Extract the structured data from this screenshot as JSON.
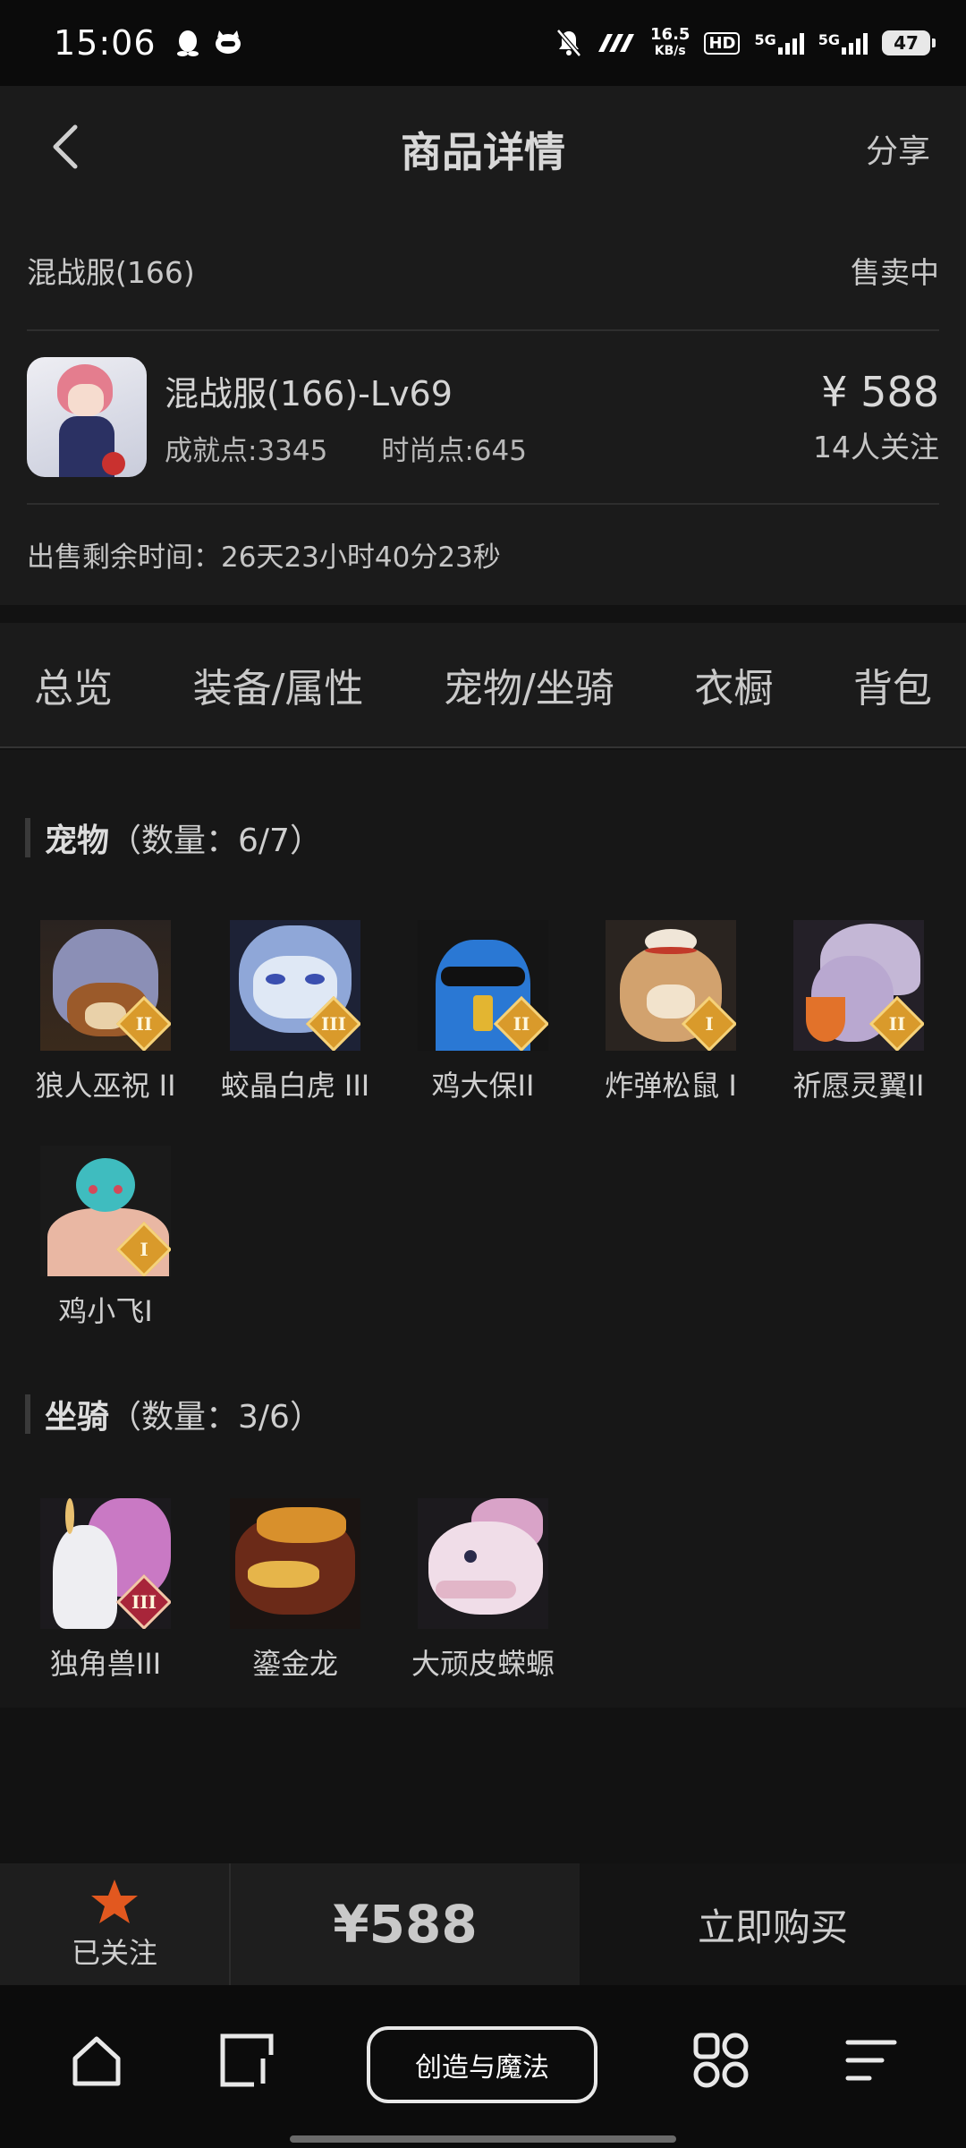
{
  "status_bar": {
    "time": "15:06",
    "speed_value": "16.5",
    "speed_unit": "KB/s",
    "hd": "HD",
    "net1": "5G",
    "net2": "5G",
    "battery": "47"
  },
  "header": {
    "title": "商品详情",
    "share": "分享",
    "back_icon": "chevron-left-icon"
  },
  "info": {
    "server": "混战服(166)",
    "status": "售卖中",
    "product_name": "混战服(166)-Lv69",
    "achievement": "成就点:3345",
    "fashion": "时尚点:645",
    "price": "¥ 588",
    "followers": "14人关注",
    "remaining_time": "出售剩余时间：26天23小时40分23秒"
  },
  "tabs": [
    {
      "label": "总览"
    },
    {
      "label": "装备/属性"
    },
    {
      "label": "宠物/坐骑"
    },
    {
      "label": "衣橱"
    },
    {
      "label": "背包"
    }
  ],
  "pets": {
    "title": "宠物",
    "count": "（数量：6/7）",
    "items": [
      {
        "name": "狼人巫祝 II",
        "rank": "II"
      },
      {
        "name": "蛟晶白虎 III",
        "rank": "III"
      },
      {
        "name": "鸡大保II",
        "rank": "II"
      },
      {
        "name": "炸弹松鼠 I",
        "rank": "I"
      },
      {
        "name": "祈愿灵翼II",
        "rank": "II"
      },
      {
        "name": "鸡小飞I",
        "rank": "I"
      }
    ]
  },
  "mounts": {
    "title": "坐骑",
    "count": "（数量：3/6）",
    "items": [
      {
        "name": "独角兽III",
        "rank": "III"
      },
      {
        "name": "鎏金龙",
        "rank": ""
      },
      {
        "name": "大顽皮蝾螈",
        "rank": ""
      }
    ]
  },
  "action_bar": {
    "follow_label": "已关注",
    "price": "¥588",
    "buy_label": "立即购买",
    "accent": "#e2581f"
  },
  "nav": {
    "center_label": "创造与魔法",
    "icons": [
      "home-icon",
      "recent-apps-icon",
      "app-grid-icon",
      "menu-icon"
    ]
  }
}
